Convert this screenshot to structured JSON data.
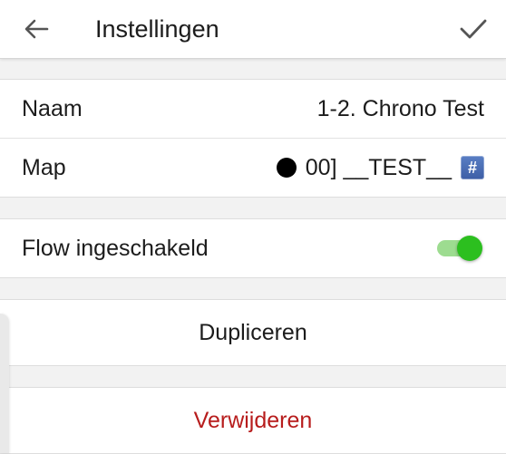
{
  "appbar": {
    "title": "Instellingen",
    "back_icon": "arrow-left-icon",
    "confirm_icon": "check-icon"
  },
  "settings": {
    "name_label": "Naam",
    "name_value": "1-2. Chrono Test",
    "folder_label": "Map",
    "folder_value": "00] __TEST__",
    "folder_hash": "#",
    "flow_label": "Flow ingeschakeld",
    "flow_enabled": true
  },
  "actions": {
    "duplicate": "Dupliceren",
    "delete": "Verwijderen"
  },
  "colors": {
    "toggle_on": "#2cbf1f",
    "danger": "#b71c1c",
    "background": "#f2f2f2"
  }
}
